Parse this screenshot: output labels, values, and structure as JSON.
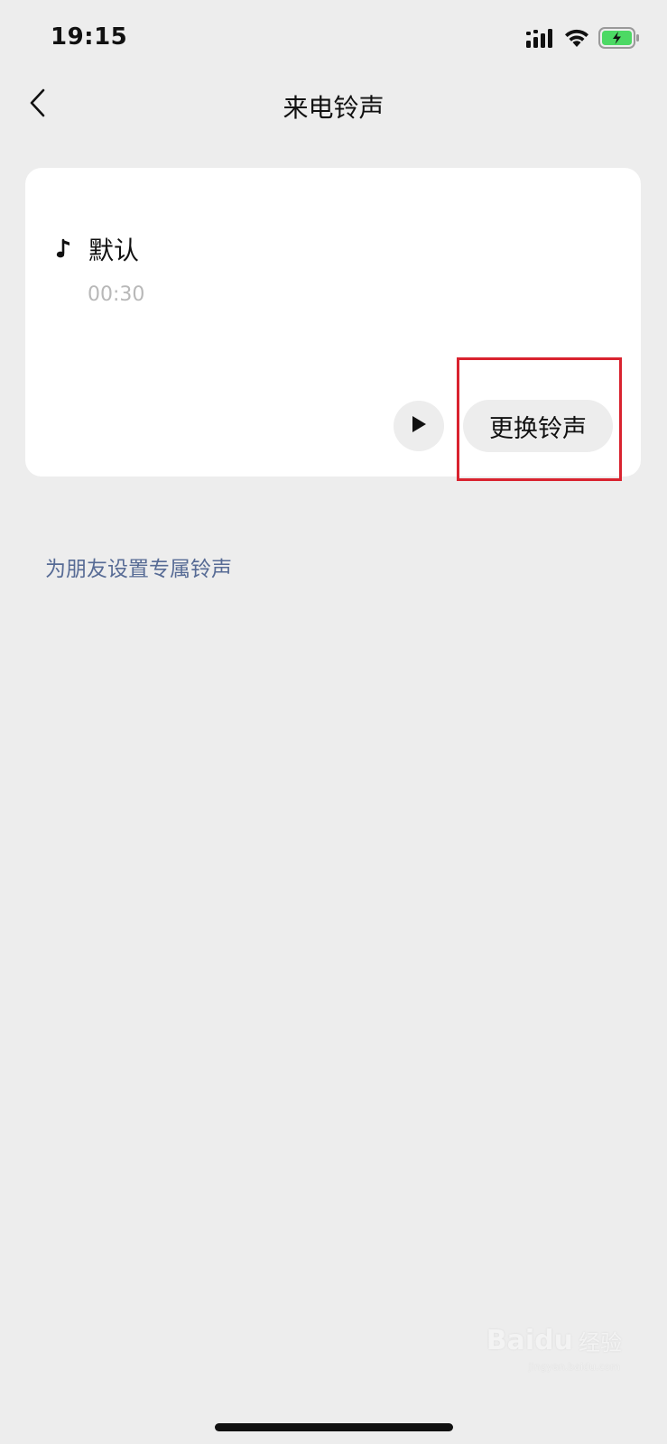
{
  "status_bar": {
    "time": "19:15",
    "battery_color": "#4cd964",
    "signal_icon": "signal-bars-icon",
    "wifi_icon": "wifi-icon",
    "battery_icon": "battery-charging-icon"
  },
  "nav": {
    "back_icon": "chevron-left-icon",
    "title": "来电铃声"
  },
  "ringtone_card": {
    "icon": "music-note-icon",
    "name": "默认",
    "duration": "00:30",
    "play_icon": "play-icon",
    "change_label": "更换铃声",
    "highlight_color": "#d9232f"
  },
  "friend_link": {
    "label": "为朋友设置专属铃声",
    "color": "#576b95"
  },
  "watermark": {
    "logo": "Bai",
    "logo_suffix": "du",
    "cn": "经验",
    "sub": "jingyan.baidu.com"
  }
}
